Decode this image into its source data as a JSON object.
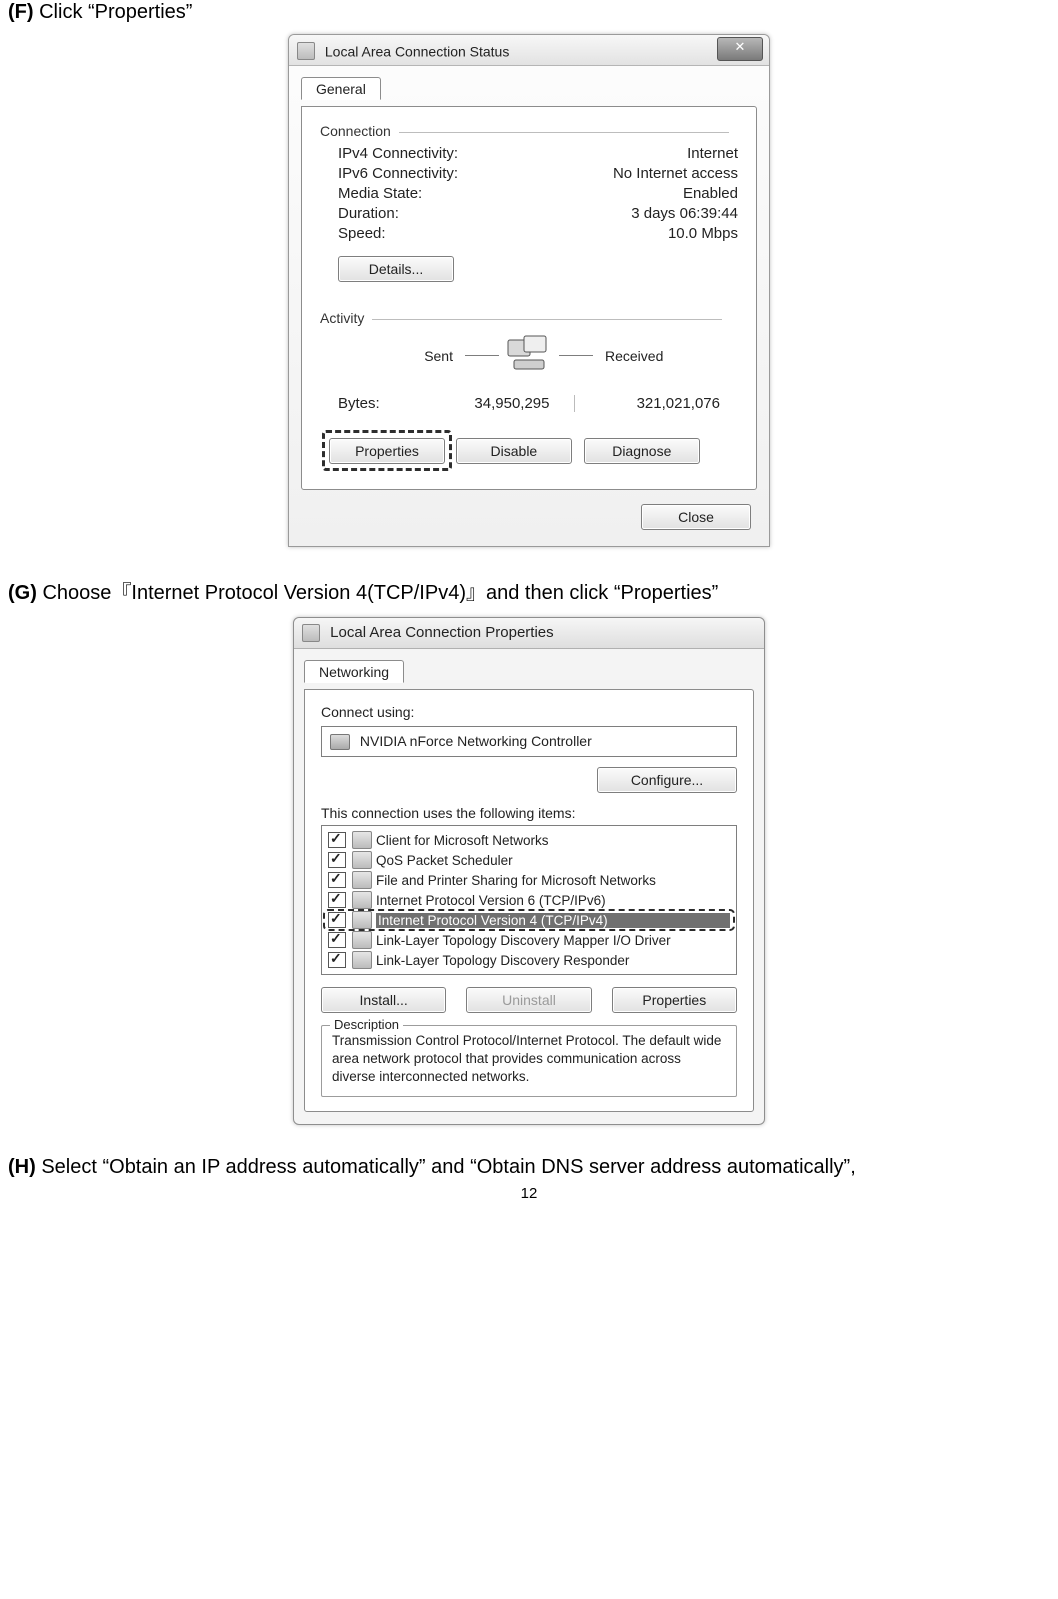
{
  "page_number": "12",
  "steps": {
    "F": {
      "label": "(F)",
      "text": "Click “Properties”"
    },
    "G": {
      "label": "(G)",
      "text": "Choose『Internet Protocol Version 4(TCP/IPv4)』and then click “Properties”"
    },
    "H": {
      "label": "(H)",
      "text": "Select “Obtain an IP address automatically” and “Obtain DNS server address automatically”,"
    }
  },
  "dialog1": {
    "title": "Local Area Connection Status",
    "close_glyph": "✕",
    "tab": "General",
    "group_connection": "Connection",
    "rows": {
      "ipv4_l": "IPv4 Connectivity:",
      "ipv4_v": "Internet",
      "ipv6_l": "IPv6 Connectivity:",
      "ipv6_v": "No Internet access",
      "media_l": "Media State:",
      "media_v": "Enabled",
      "dur_l": "Duration:",
      "dur_v": "3 days 06:39:44",
      "spd_l": "Speed:",
      "spd_v": "10.0 Mbps"
    },
    "details_btn": "Details...",
    "group_activity": "Activity",
    "sent_label": "Sent",
    "received_label": "Received",
    "bytes_label": "Bytes:",
    "bytes_sent": "34,950,295",
    "bytes_recv": "321,021,076",
    "properties_btn": "Properties",
    "disable_btn": "Disable",
    "diagnose_btn": "Diagnose",
    "close_btn": "Close"
  },
  "dialog2": {
    "title": "Local Area Connection Properties",
    "tab": "Networking",
    "connect_using": "Connect using:",
    "adapter": "NVIDIA nForce Networking Controller",
    "configure_btn": "Configure...",
    "items_label": "This connection uses the following items:",
    "items": [
      "Client for Microsoft Networks",
      "QoS Packet Scheduler",
      "File and Printer Sharing for Microsoft Networks",
      "Internet Protocol Version 6 (TCP/IPv6)",
      "Internet Protocol Version 4 (TCP/IPv4)",
      "Link-Layer Topology Discovery Mapper I/O Driver",
      "Link-Layer Topology Discovery Responder"
    ],
    "install_btn": "Install...",
    "uninstall_btn": "Uninstall",
    "properties_btn": "Properties",
    "desc_label": "Description",
    "desc_text": "Transmission Control Protocol/Internet Protocol. The default wide area network protocol that provides communication across diverse interconnected networks."
  }
}
